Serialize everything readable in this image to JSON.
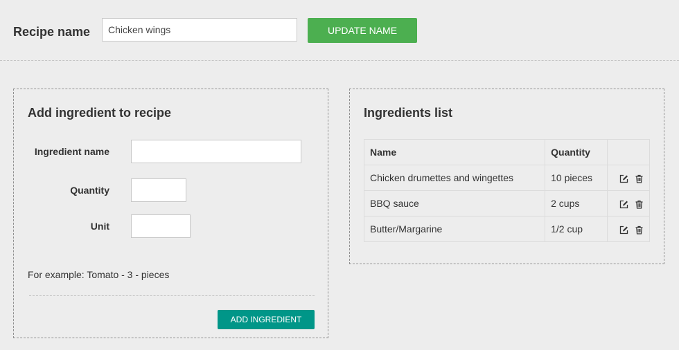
{
  "header": {
    "recipe_label": "Recipe name",
    "recipe_input_value": "Chicken wings",
    "update_button": "Update name"
  },
  "add_panel": {
    "title": "Add ingredient to recipe",
    "fields": {
      "ingredient_name": {
        "label": "Ingredient name",
        "value": ""
      },
      "quantity": {
        "label": "Quantity",
        "value": ""
      },
      "unit": {
        "label": "Unit",
        "value": ""
      }
    },
    "example": "For example: Tomato - 3 - pieces",
    "add_button": "Add ingredient"
  },
  "list_panel": {
    "title": "Ingredients list",
    "columns": [
      "Name",
      "Quantity",
      ""
    ],
    "rows": [
      {
        "name": "Chicken drumettes and wingettes",
        "quantity": "10 pieces",
        "actions": [
          "edit-icon",
          "trash-icon"
        ]
      },
      {
        "name": "BBQ sauce",
        "quantity": "2 cups",
        "actions": [
          "edit-icon",
          "trash-icon"
        ]
      },
      {
        "name": "Butter/Margarine",
        "quantity": "1/2 cup",
        "actions": [
          "edit-icon",
          "trash-icon"
        ]
      }
    ]
  },
  "colors": {
    "update_button": "#4caf50",
    "add_button": "#009688",
    "background": "#ededed"
  }
}
